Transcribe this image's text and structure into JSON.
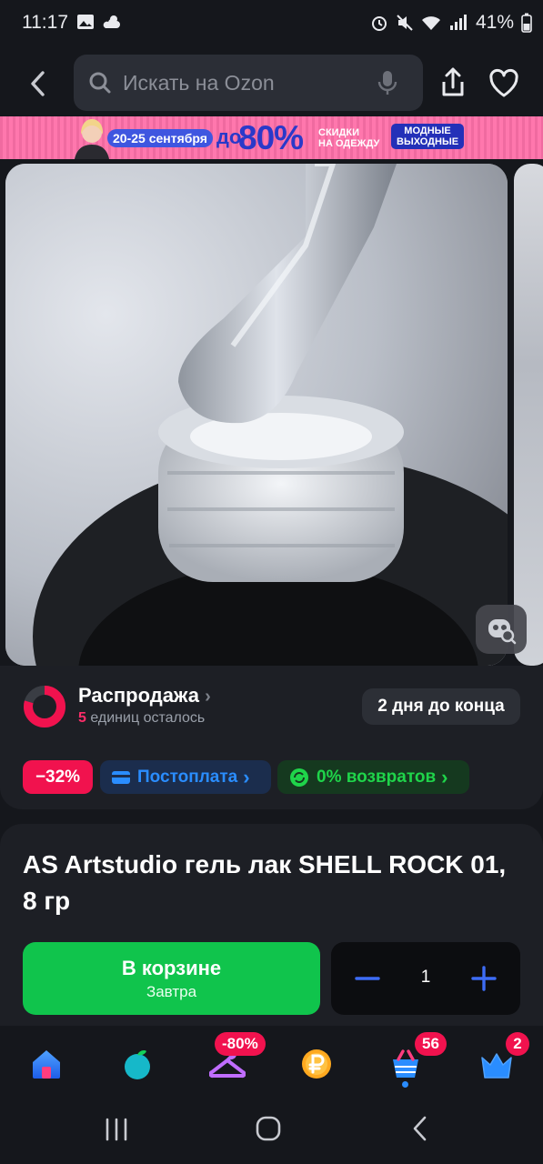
{
  "status_bar": {
    "time": "11:17",
    "battery": "41%",
    "icons": [
      "gallery-icon",
      "weather-icon",
      "alarm-icon",
      "mute-icon",
      "wifi-icon",
      "signal-icon",
      "battery-icon"
    ]
  },
  "header": {
    "search_placeholder": "Искать на Ozon"
  },
  "banner": {
    "dates": "20-25 сентября",
    "prefix": "до",
    "percent": "80%",
    "subtitle_line1": "СКИДКИ",
    "subtitle_line2": "НА ОДЕЖДУ",
    "badge_line1": "МОДНЫЕ",
    "badge_line2": "ВЫХОДНЫЕ"
  },
  "sale": {
    "title": "Распродажа",
    "remaining_count": "5",
    "remaining_text": "единиц осталось",
    "days_left": "2 дня до конца"
  },
  "tags": {
    "discount": "−32%",
    "postpay": "Постоплата",
    "returns": "0% возвратов"
  },
  "product": {
    "title": "AS Artstudio гель лак SHELL ROCK 01, 8 гр"
  },
  "cart": {
    "label": "В корзине",
    "delivery": "Завтра",
    "quantity": "1"
  },
  "bottom_nav": {
    "items": [
      {
        "icon": "home-icon"
      },
      {
        "icon": "fresh-icon"
      },
      {
        "icon": "hanger-icon",
        "badge": "-80%"
      },
      {
        "icon": "ruble-coin-icon"
      },
      {
        "icon": "cart-icon",
        "badge": "56"
      },
      {
        "icon": "crown-icon",
        "badge": "2"
      }
    ]
  },
  "colors": {
    "accent_green": "#10c44c",
    "accent_blue": "#2a8dff",
    "accent_pink": "#f1124e"
  }
}
